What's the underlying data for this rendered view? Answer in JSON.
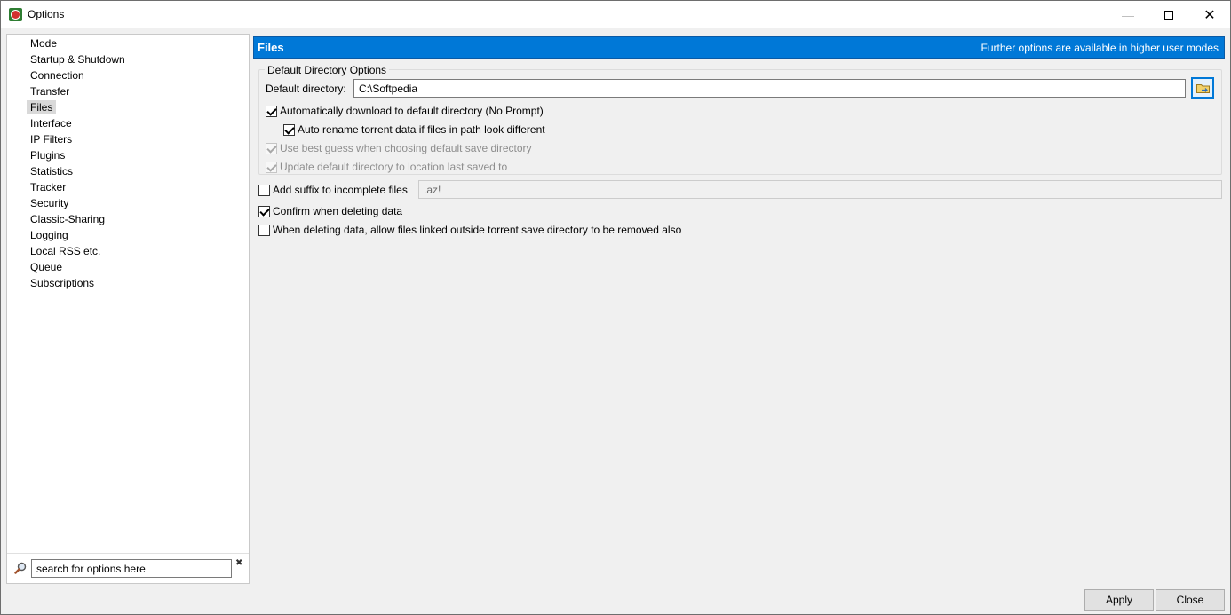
{
  "window": {
    "title": "Options",
    "controls": {
      "minimize": "—",
      "close": "✕"
    }
  },
  "sidebar": {
    "items": [
      {
        "label": "Mode"
      },
      {
        "label": "Startup & Shutdown"
      },
      {
        "label": "Connection"
      },
      {
        "label": "Transfer"
      },
      {
        "label": "Files",
        "selected": true
      },
      {
        "label": "Interface"
      },
      {
        "label": "IP Filters"
      },
      {
        "label": "Plugins"
      },
      {
        "label": "Statistics"
      },
      {
        "label": "Tracker"
      },
      {
        "label": "Security"
      },
      {
        "label": "Classic-Sharing"
      },
      {
        "label": "Logging"
      },
      {
        "label": "Local RSS etc."
      },
      {
        "label": "Queue"
      },
      {
        "label": "Subscriptions"
      }
    ],
    "search": {
      "value": "search for options here",
      "clear_icon": "✖"
    }
  },
  "header": {
    "title": "Files",
    "note": "Further options are available in higher user modes",
    "color": "#0078d7"
  },
  "default_dir_group": {
    "legend": "Default Directory Options",
    "dir_label": "Default directory:",
    "dir_value": "C:\\Softpedia",
    "options": [
      {
        "label": "Automatically download to default directory (No Prompt)",
        "checked": true,
        "disabled": false
      },
      {
        "label": "Auto rename torrent data if files in path look different",
        "checked": true,
        "disabled": false
      },
      {
        "label": "Use best guess when choosing default save directory",
        "checked": true,
        "disabled": true
      },
      {
        "label": "Update default directory to location last saved to",
        "checked": true,
        "disabled": true
      }
    ]
  },
  "suffix": {
    "label": "Add suffix to incomplete files",
    "checked": false,
    "value": ".az!"
  },
  "confirm_delete": {
    "label": "Confirm when deleting data",
    "checked": true
  },
  "linked_delete": {
    "label": "When deleting data, allow files linked outside torrent save directory to be removed also",
    "checked": false
  },
  "buttons": {
    "apply": "Apply",
    "close": "Close"
  }
}
